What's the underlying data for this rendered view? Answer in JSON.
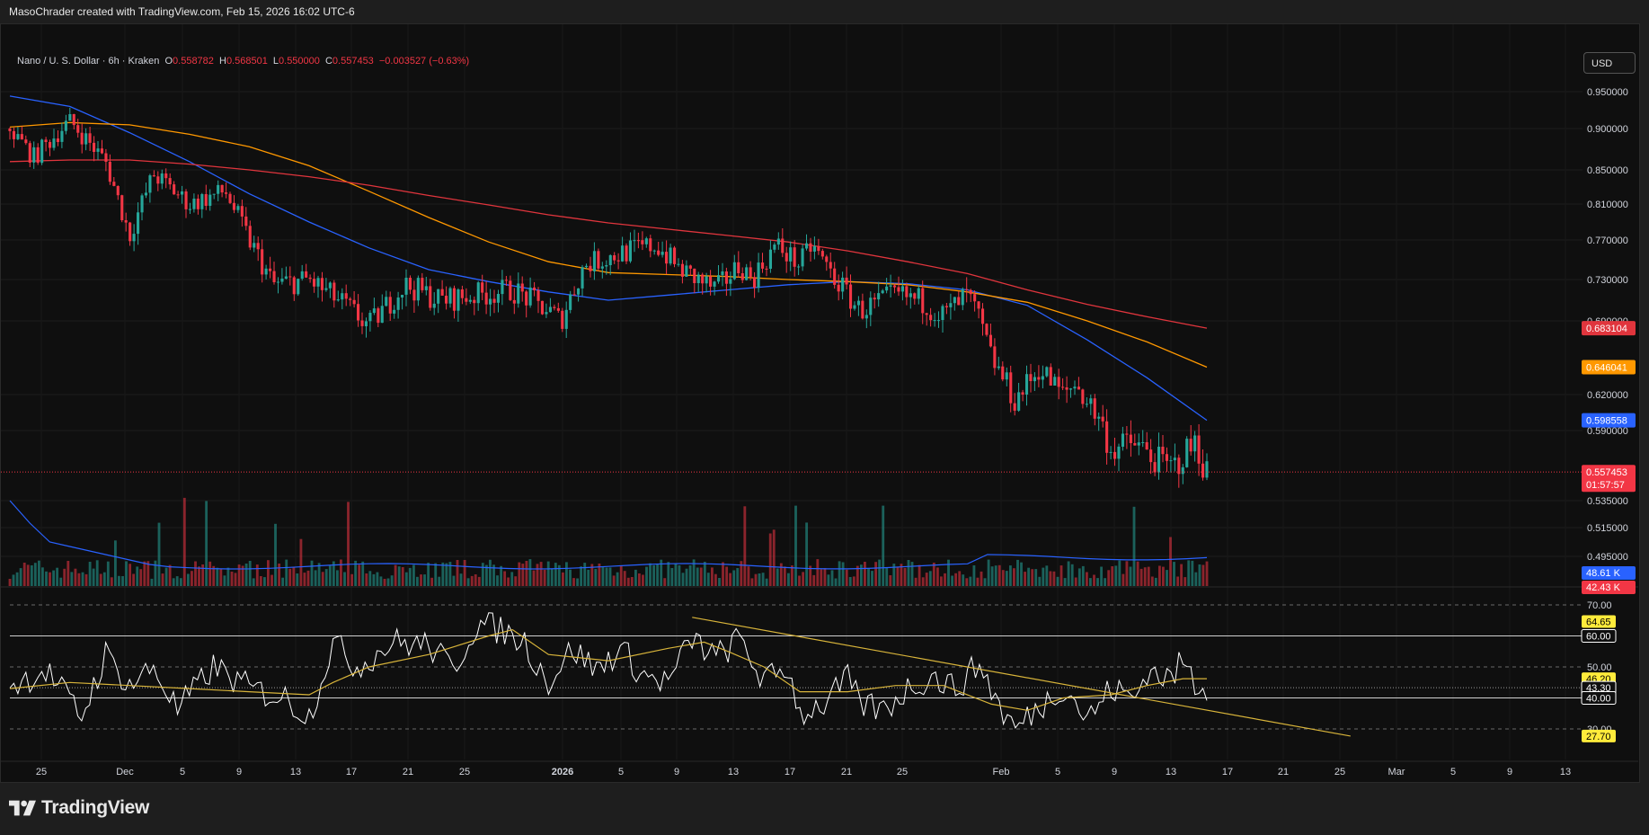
{
  "caption": "MasoChrader created with TradingView.com, Feb 15, 2026 16:02 UTC-6",
  "legend": {
    "symbol": "Nano / U. S. Dollar · 6h · Kraken",
    "open_label": "O",
    "open": "0.558782",
    "high_label": "H",
    "high": "0.568501",
    "low_label": "L",
    "low": "0.550000",
    "close_label": "C",
    "close": "0.557453",
    "change": "−0.003527 (−0.63%)"
  },
  "currency": "USD",
  "footer": {
    "brand": "TradingView"
  },
  "colors": {
    "up": "#26a69a",
    "down": "#f23645",
    "ma_short": "#2962ff",
    "ma_mid": "#ff9800",
    "ma_long": "#e0353d",
    "rsi": "#ffffff",
    "rsi_ma": "#d8b43a",
    "trendline": "#d8b43a",
    "volume_ma": "#2962ff"
  },
  "chart_data": [
    {
      "type": "candlestick",
      "symbol": "Nano / U. S. Dollar · 6h · Kraken",
      "price_axis_ticks": [
        "0.950000",
        "0.900000",
        "0.850000",
        "0.810000",
        "0.770000",
        "0.730000",
        "0.690000",
        "0.620000",
        "0.590000",
        "0.535000",
        "0.515000",
        "0.495000"
      ],
      "time_axis_ticks": [
        "25",
        "Dec",
        "5",
        "9",
        "13",
        "17",
        "21",
        "25",
        "2026",
        "5",
        "9",
        "13",
        "17",
        "21",
        "25",
        "Feb",
        "5",
        "9",
        "13",
        "17",
        "21",
        "25",
        "Mar",
        "5",
        "9",
        "13"
      ],
      "price_badges": [
        {
          "label": "0.683104",
          "color": "#e0353d"
        },
        {
          "label": "0.646041",
          "color": "#ff9800"
        },
        {
          "label": "0.598558",
          "color": "#2962ff"
        },
        {
          "label": "0.557453",
          "color": "#f23645",
          "sub": "01:57:57"
        }
      ],
      "moving_averages": [
        {
          "color": "#2962ff",
          "points": [
            [
              0,
              0.944
            ],
            [
              0.05,
              0.93
            ],
            [
              0.1,
              0.895
            ],
            [
              0.15,
              0.86
            ],
            [
              0.2,
              0.822
            ],
            [
              0.25,
              0.79
            ],
            [
              0.3,
              0.762
            ],
            [
              0.35,
              0.74
            ],
            [
              0.4,
              0.728
            ],
            [
              0.45,
              0.718
            ],
            [
              0.5,
              0.71
            ],
            [
              0.55,
              0.715
            ],
            [
              0.6,
              0.72
            ],
            [
              0.65,
              0.725
            ],
            [
              0.7,
              0.728
            ],
            [
              0.75,
              0.726
            ],
            [
              0.8,
              0.72
            ],
            [
              0.85,
              0.705
            ],
            [
              0.9,
              0.672
            ],
            [
              0.95,
              0.636
            ],
            [
              1,
              0.598558
            ]
          ]
        },
        {
          "color": "#ff9800",
          "points": [
            [
              0,
              0.902
            ],
            [
              0.05,
              0.908
            ],
            [
              0.1,
              0.905
            ],
            [
              0.15,
              0.893
            ],
            [
              0.2,
              0.878
            ],
            [
              0.25,
              0.855
            ],
            [
              0.3,
              0.825
            ],
            [
              0.35,
              0.795
            ],
            [
              0.4,
              0.768
            ],
            [
              0.45,
              0.748
            ],
            [
              0.5,
              0.737
            ],
            [
              0.55,
              0.735
            ],
            [
              0.6,
              0.733
            ],
            [
              0.65,
              0.73
            ],
            [
              0.7,
              0.728
            ],
            [
              0.75,
              0.725
            ],
            [
              0.8,
              0.718
            ],
            [
              0.85,
              0.708
            ],
            [
              0.9,
              0.69
            ],
            [
              0.95,
              0.67
            ],
            [
              1,
              0.646041
            ]
          ]
        },
        {
          "color": "#e0353d",
          "points": [
            [
              0,
              0.86
            ],
            [
              0.05,
              0.862
            ],
            [
              0.1,
              0.862
            ],
            [
              0.15,
              0.857
            ],
            [
              0.2,
              0.85
            ],
            [
              0.25,
              0.842
            ],
            [
              0.3,
              0.832
            ],
            [
              0.35,
              0.82
            ],
            [
              0.4,
              0.809
            ],
            [
              0.45,
              0.798
            ],
            [
              0.5,
              0.789
            ],
            [
              0.55,
              0.782
            ],
            [
              0.6,
              0.775
            ],
            [
              0.65,
              0.768
            ],
            [
              0.7,
              0.759
            ],
            [
              0.75,
              0.748
            ],
            [
              0.8,
              0.736
            ],
            [
              0.85,
              0.72
            ],
            [
              0.9,
              0.706
            ],
            [
              0.95,
              0.694
            ],
            [
              1,
              0.683104
            ]
          ]
        }
      ],
      "price_path": [
        [
          0,
          0.9
        ],
        [
          0.02,
          0.865
        ],
        [
          0.05,
          0.91
        ],
        [
          0.08,
          0.86
        ],
        [
          0.1,
          0.775
        ],
        [
          0.12,
          0.845
        ],
        [
          0.15,
          0.81
        ],
        [
          0.18,
          0.825
        ],
        [
          0.2,
          0.77
        ],
        [
          0.22,
          0.725
        ],
        [
          0.25,
          0.73
        ],
        [
          0.28,
          0.705
        ],
        [
          0.3,
          0.685
        ],
        [
          0.33,
          0.725
        ],
        [
          0.36,
          0.71
        ],
        [
          0.39,
          0.715
        ],
        [
          0.42,
          0.72
        ],
        [
          0.45,
          0.7
        ],
        [
          0.46,
          0.69
        ],
        [
          0.48,
          0.745
        ],
        [
          0.52,
          0.76
        ],
        [
          0.54,
          0.765
        ],
        [
          0.56,
          0.74
        ],
        [
          0.59,
          0.72
        ],
        [
          0.61,
          0.745
        ],
        [
          0.62,
          0.73
        ],
        [
          0.64,
          0.765
        ],
        [
          0.66,
          0.745
        ],
        [
          0.67,
          0.765
        ],
        [
          0.69,
          0.73
        ],
        [
          0.71,
          0.7
        ],
        [
          0.74,
          0.715
        ],
        [
          0.76,
          0.71
        ],
        [
          0.78,
          0.695
        ],
        [
          0.8,
          0.715
        ],
        [
          0.81,
          0.69
        ],
        [
          0.82,
          0.655
        ],
        [
          0.84,
          0.615
        ],
        [
          0.86,
          0.645
        ],
        [
          0.88,
          0.62
        ],
        [
          0.89,
          0.63
        ],
        [
          0.9,
          0.615
        ],
        [
          0.91,
          0.6
        ],
        [
          0.92,
          0.575
        ],
        [
          0.94,
          0.58
        ],
        [
          0.96,
          0.565
        ],
        [
          0.97,
          0.56
        ],
        [
          0.98,
          0.57
        ],
        [
          0.99,
          0.58
        ],
        [
          1,
          0.557453
        ]
      ]
    },
    {
      "type": "bar",
      "name": "Volume",
      "badges": [
        {
          "label": "48.61 K",
          "color": "#2962ff"
        },
        {
          "label": "42.43 K",
          "color": "#f23645"
        }
      ]
    },
    {
      "type": "line",
      "name": "RSI",
      "axis_ticks": [
        "70.00",
        "60.00",
        "50.00",
        "40.00",
        "30.00"
      ],
      "levels": [
        70,
        60,
        50,
        40,
        30
      ],
      "badges": [
        {
          "label": "64.65",
          "color": "#ffeb3b"
        },
        {
          "label": "60.00",
          "color": "#ffffff"
        },
        {
          "label": "46.20",
          "color": "#ffeb3b"
        },
        {
          "label": "43.30",
          "color": "#ffffff"
        },
        {
          "label": "40.00",
          "color": "#ffffff"
        },
        {
          "label": "27.70",
          "color": "#ffeb3b"
        }
      ],
      "trendline": {
        "from": [
          0.57,
          66
        ],
        "to": [
          1.12,
          27.7
        ]
      },
      "rsi_path": [
        [
          0,
          44
        ],
        [
          0.03,
          49
        ],
        [
          0.06,
          34
        ],
        [
          0.08,
          54
        ],
        [
          0.1,
          44
        ],
        [
          0.12,
          50
        ],
        [
          0.14,
          36
        ],
        [
          0.17,
          50
        ],
        [
          0.2,
          43
        ],
        [
          0.23,
          40
        ],
        [
          0.25,
          34
        ],
        [
          0.27,
          58
        ],
        [
          0.29,
          50
        ],
        [
          0.32,
          58
        ],
        [
          0.35,
          57
        ],
        [
          0.37,
          49
        ],
        [
          0.39,
          64
        ],
        [
          0.41,
          62
        ],
        [
          0.43,
          58
        ],
        [
          0.45,
          45
        ],
        [
          0.47,
          56
        ],
        [
          0.49,
          49
        ],
        [
          0.51,
          56
        ],
        [
          0.53,
          47
        ],
        [
          0.55,
          45
        ],
        [
          0.57,
          59
        ],
        [
          0.59,
          53
        ],
        [
          0.61,
          59
        ],
        [
          0.63,
          45
        ],
        [
          0.65,
          50
        ],
        [
          0.66,
          35
        ],
        [
          0.68,
          38
        ],
        [
          0.7,
          46
        ],
        [
          0.71,
          38
        ],
        [
          0.73,
          36
        ],
        [
          0.75,
          43
        ],
        [
          0.77,
          47
        ],
        [
          0.79,
          43
        ],
        [
          0.81,
          51
        ],
        [
          0.83,
          35
        ],
        [
          0.84,
          30
        ],
        [
          0.86,
          37
        ],
        [
          0.88,
          44
        ],
        [
          0.89,
          39
        ],
        [
          0.9,
          33
        ],
        [
          0.92,
          43
        ],
        [
          0.94,
          40
        ],
        [
          0.95,
          49
        ],
        [
          0.97,
          46
        ],
        [
          0.98,
          52
        ],
        [
          0.99,
          45
        ],
        [
          1,
          43.3
        ]
      ],
      "rsi_ma_path": [
        [
          0,
          43
        ],
        [
          0.05,
          45
        ],
        [
          0.1,
          44
        ],
        [
          0.15,
          43
        ],
        [
          0.2,
          42
        ],
        [
          0.25,
          41
        ],
        [
          0.27,
          45
        ],
        [
          0.3,
          50
        ],
        [
          0.35,
          54
        ],
        [
          0.4,
          60
        ],
        [
          0.42,
          62
        ],
        [
          0.45,
          54
        ],
        [
          0.5,
          52
        ],
        [
          0.55,
          56
        ],
        [
          0.58,
          58
        ],
        [
          0.6,
          55
        ],
        [
          0.63,
          50
        ],
        [
          0.66,
          42
        ],
        [
          0.7,
          42
        ],
        [
          0.74,
          44
        ],
        [
          0.78,
          44
        ],
        [
          0.82,
          38
        ],
        [
          0.85,
          36
        ],
        [
          0.88,
          40
        ],
        [
          0.92,
          41
        ],
        [
          0.95,
          44
        ],
        [
          0.98,
          46.2
        ],
        [
          1,
          46.2
        ]
      ]
    }
  ]
}
